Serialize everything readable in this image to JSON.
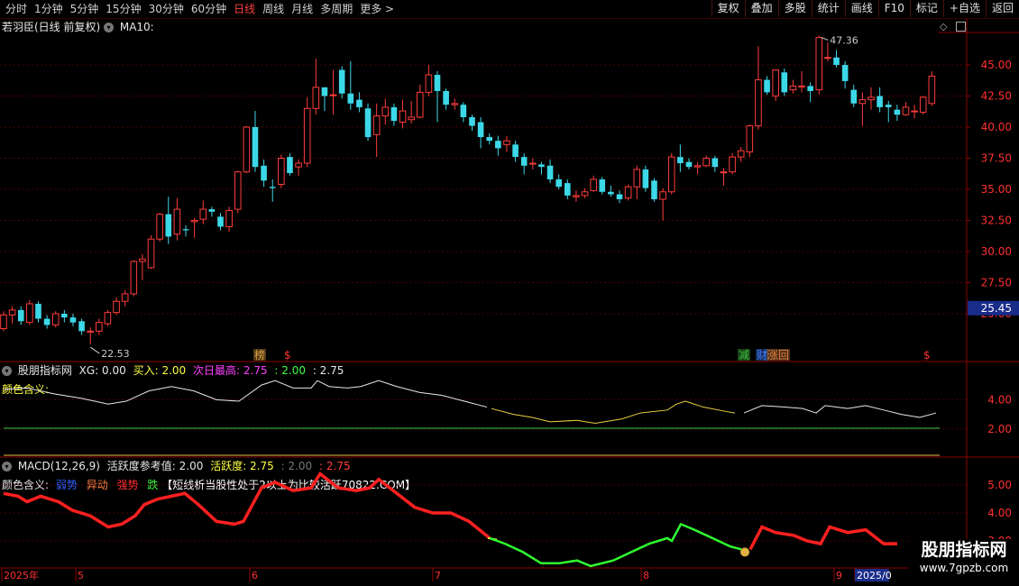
{
  "toolbar": {
    "periods": [
      {
        "label": "分时",
        "active": false
      },
      {
        "label": "1分钟",
        "active": false
      },
      {
        "label": "5分钟",
        "active": false
      },
      {
        "label": "15分钟",
        "active": false
      },
      {
        "label": "30分钟",
        "active": false
      },
      {
        "label": "60分钟",
        "active": false
      },
      {
        "label": "日线",
        "active": true
      },
      {
        "label": "周线",
        "active": false
      },
      {
        "label": "月线",
        "active": false
      },
      {
        "label": "多周期",
        "active": false
      },
      {
        "label": "更多 >",
        "active": false
      }
    ],
    "buttons": [
      "复权",
      "叠加",
      "多股",
      "统计",
      "画线",
      "F10",
      "标记",
      "+自选",
      "返回"
    ]
  },
  "main_header": {
    "stock": "若羽臣(日线 前复权)",
    "ma": "MA10:"
  },
  "price_axis": {
    "labels": [
      "45.00",
      "42.50",
      "40.00",
      "37.50",
      "35.00",
      "32.50",
      "30.00",
      "27.50",
      "25.00"
    ],
    "current": "25.45",
    "high_note": "47.36",
    "low_note": "22.53"
  },
  "markers": [
    {
      "text": "榜",
      "color": "#e0a040"
    },
    {
      "text": "$",
      "color": "#ff3030"
    },
    {
      "text": "减",
      "color": "#40c040"
    },
    {
      "text": "财",
      "color": "#4080ff"
    },
    {
      "text": "涨回",
      "color": "#e08040"
    },
    {
      "text": "$",
      "color": "#ff3030"
    }
  ],
  "ind1": {
    "name": "股朋指标网",
    "xg": "XG: 0.00",
    "buy": "买入: 2.00",
    "next_high": "次日最高: 2.75",
    "v1": ": 2.00",
    "v2": ": 2.75",
    "legend": "颜色含义:",
    "axis": [
      "4.00",
      "2.00"
    ]
  },
  "ind2": {
    "name": "MACD(12,26,9)",
    "ref": "活跃度参考值: 2.00",
    "act": "活跃度: 2.75",
    "v1": ": 2.00",
    "v2": ": 2.75",
    "legend_label": "颜色含义:",
    "weak": "弱势",
    "move": "异动",
    "strong": "强势",
    "fall": "跌",
    "note": "【短线析当股性处于2以上为比较活跃70822.COM】",
    "axis": [
      "5.00",
      "4.00",
      "3.00"
    ]
  },
  "date_axis": {
    "labels": [
      "2025年",
      "5",
      "6",
      "7",
      "8",
      "9",
      "2025/0"
    ]
  },
  "watermark": {
    "title": "股朋指标网",
    "url": "www.7gpzb.com"
  },
  "colors": {
    "up": "#ff3c3c",
    "down": "#3cd8e8",
    "axis": "#8b0000",
    "grid": "#500000",
    "accent": "#ff3030"
  }
}
